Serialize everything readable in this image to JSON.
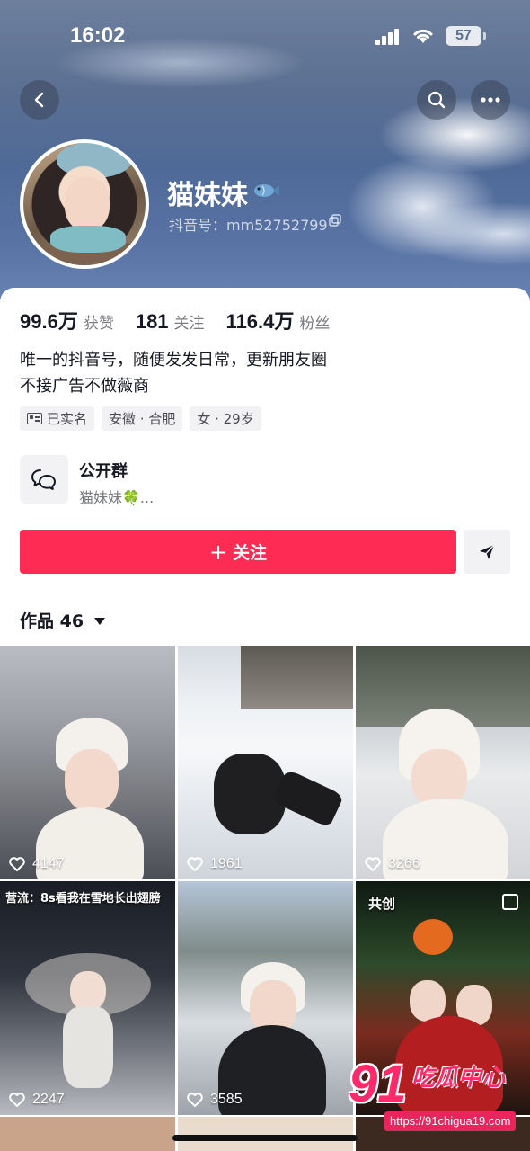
{
  "status_bar": {
    "time": "16:02",
    "battery": "57"
  },
  "profile": {
    "nickname": "猫妹妹",
    "douyin_id": "抖音号：mm52752799",
    "stats": [
      {
        "num": "99.6万",
        "label": "获赞"
      },
      {
        "num": "181",
        "label": "关注"
      },
      {
        "num": "116.4万",
        "label": "粉丝"
      }
    ],
    "bio_line1": "唯一的抖音号，随便发发日常，更新朋友圈",
    "bio_line2": "不接广告不做薇商",
    "tags": [
      "已实名",
      "安徽 · 合肥",
      "女 · 29岁"
    ]
  },
  "group": {
    "title": "公开群",
    "subtitle": "猫妹妹🍀..."
  },
  "actions": {
    "follow_label": "关注",
    "follow_prefix": "+"
  },
  "works": {
    "label": "作品 46"
  },
  "videos": [
    {
      "likes": "4147"
    },
    {
      "likes": "1961"
    },
    {
      "likes": "3266"
    },
    {
      "likes": "2247",
      "caption": "营流：8s看我在雪地长出翅膀"
    },
    {
      "likes": "3585"
    },
    {
      "badge": "共创"
    }
  ],
  "watermark": {
    "number": "91",
    "name": "吃瓜中心",
    "url": "https://91chigua19.com"
  },
  "colors": {
    "accent": "#fe2c55"
  }
}
